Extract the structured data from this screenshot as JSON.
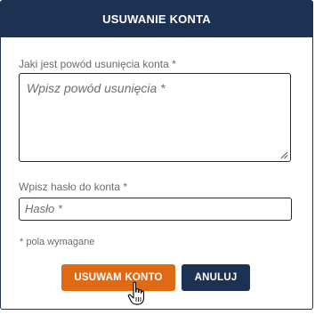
{
  "dialog": {
    "title": "USUWANIE KONTA"
  },
  "form": {
    "reason_label": "Jaki jest powód usunięcia konta *",
    "reason_placeholder": "Wpisz powód usunięcia *",
    "password_label": "Wpisz hasło do konta *",
    "password_placeholder": "Hasło *",
    "required_note": "* pola wymagane"
  },
  "actions": {
    "confirm_label": "USUWAM KONTO",
    "cancel_label": "ANULUJ"
  },
  "colors": {
    "header": "#1d3152",
    "confirm": "#e06a14",
    "cancel": "#1d3152"
  },
  "icons": {
    "cursor": "hand-pointer-icon",
    "grip": "resize-grip-icon"
  }
}
